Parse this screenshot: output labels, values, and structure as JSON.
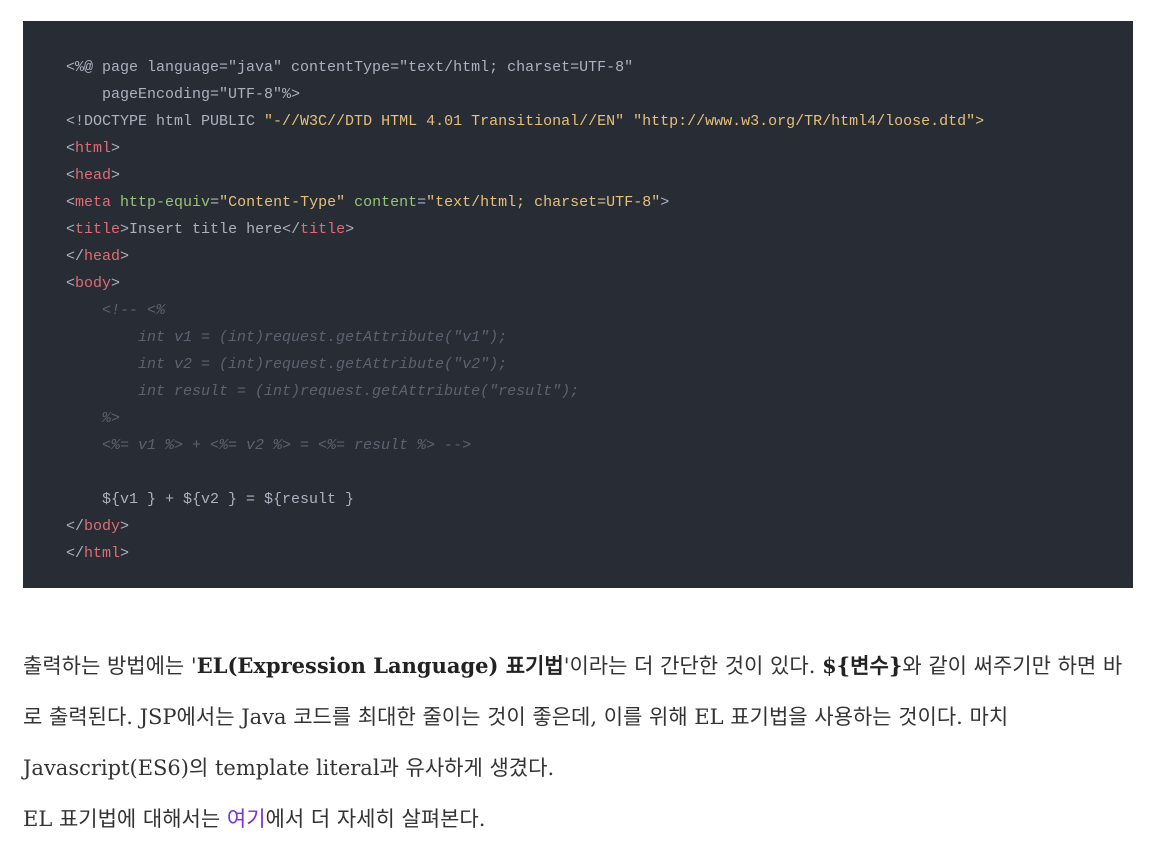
{
  "code": {
    "l1_open": "<%@ page language=",
    "l1_lang": "\"java\"",
    "l1_ct": " contentType=",
    "l1_ctval": "\"text/html; charset=UTF-8\"",
    "l2_pe": "    pageEncoding=",
    "l2_peval": "\"UTF-8\"",
    "l2_close": "%>",
    "l3_doctype": "<!DOCTYPE html PUBLIC ",
    "l3_str1": "\"-//W3C//DTD HTML 4.01 Transitional//EN\"",
    "l3_space": " ",
    "l3_str2": "\"http://www.w3.org/TR/html4/loose.dtd\">",
    "lt": "<",
    "gt": ">",
    "lt_slash": "</",
    "html": "html",
    "head": "head",
    "meta": "meta",
    "title": "title",
    "body": "body",
    "sp": " ",
    "meta_attr1": "http-equiv",
    "eq": "=",
    "meta_val1": "\"Content-Type\"",
    "meta_attr2": "content",
    "meta_val2": "\"text/html; charset=UTF-8\"",
    "title_text": "Insert title here",
    "c1": "    <!-- <%",
    "c2": "        int v1 = (int)request.getAttribute(\"v1\");",
    "c3": "        int v2 = (int)request.getAttribute(\"v2\");",
    "c4": "        int result = (int)request.getAttribute(\"result\");",
    "c5": "    %>",
    "c6": "    <%= v1 %> + <%= v2 %> = <%= result %> -->",
    "el_line": "    ${v1 } + ${v2 } = ${result }"
  },
  "prose": {
    "p1_a": "출력하는 방법에는 '",
    "p1_bold1": "EL(Expression Language) 표기법",
    "p1_b": "'이라는 더 간단한 것이 있다. ",
    "p1_bold2": "${변수}",
    "p1_c": "와 같이 써주기만 하면 바로 출력된다. JSP에서는 Java 코드를 최대한 줄이는 것이 좋은데, 이를 위해 EL 표기법을 사용하는 것이다. 마치 Javascript(ES6)의 template literal과 유사하게 생겼다.",
    "p2_a": "EL 표기법에 대해서는 ",
    "p2_link": "여기",
    "p2_b": "에서 더 자세히 살펴본다."
  },
  "colors": {
    "code_bg": "#282c34",
    "tag": "#e06c75",
    "attr": "#98c379",
    "string": "#e5c07b",
    "comment": "#5c6370",
    "link": "#7b2fd6"
  }
}
